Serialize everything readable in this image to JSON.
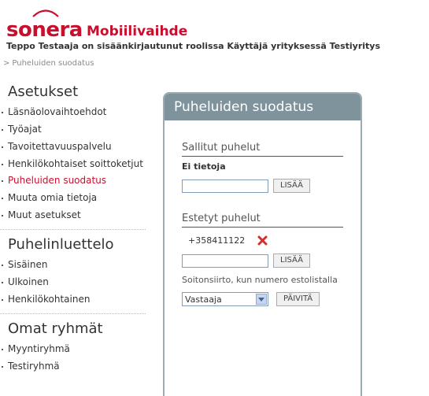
{
  "header": {
    "logo_text": "sonera",
    "app_title": "Mobiilivaihde",
    "login_info": "Teppo Testaaja on sisäänkirjautunut roolissa Käyttäjä yrityksessä Testiyritys"
  },
  "breadcrumb": {
    "separator": ">",
    "current": "Puheluiden suodatus"
  },
  "sidebar": {
    "sections": [
      {
        "heading": "Asetukset",
        "items": [
          "Läsnäolovaihtoehdot",
          "Työajat",
          "Tavoitettavuuspalvelu",
          "Henkilökohtaiset soittoketjut",
          "Puheluiden suodatus",
          "Muuta omia tietoja",
          "Muut asetukset"
        ]
      },
      {
        "heading": "Puhelinluettelo",
        "items": [
          "Sisäinen",
          "Ulkoinen",
          "Henkilökohtainen"
        ]
      },
      {
        "heading": "Omat ryhmät",
        "items": [
          "Myyntiryhmä",
          "Testiryhmä"
        ]
      }
    ]
  },
  "panel": {
    "title": "Puheluiden suodatus",
    "allowed": {
      "heading": "Sallitut puhelut",
      "empty_text": "Ei tietoja",
      "input_value": "",
      "add_label": "LISÄÄ"
    },
    "blocked": {
      "heading": "Estetyt puhelut",
      "numbers": [
        "+358411122"
      ],
      "input_value": "",
      "add_label": "LISÄÄ"
    },
    "forwarding": {
      "label": "Soitonsiirto, kun numero estolistalla",
      "selected": "Vastaaja",
      "update_label": "PÄIVITÄ"
    }
  },
  "colors": {
    "brand_red": "#c8102e",
    "panel_header": "#7e939c",
    "panel_border": "#9aabb1"
  }
}
